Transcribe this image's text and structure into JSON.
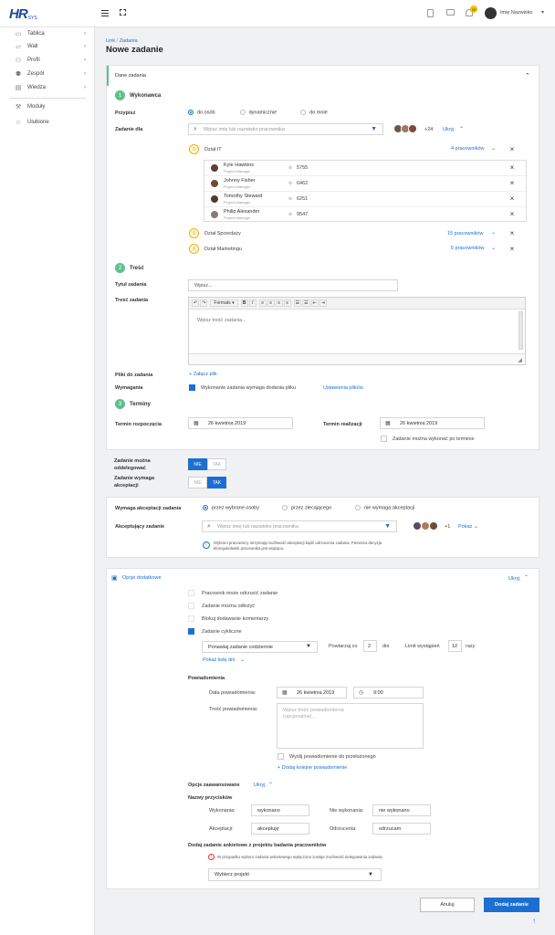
{
  "app": {
    "logo_main": "HR",
    "logo_sub": "SYS",
    "user_name": "Imię Nazwisko",
    "notif_count": "19"
  },
  "sidebar": {
    "items": [
      {
        "label": "Tablica",
        "icon": "monitor-icon",
        "chev": true
      },
      {
        "label": "Wall",
        "icon": "folder-icon",
        "chev": true
      },
      {
        "label": "Profil",
        "icon": "user-icon",
        "chev": true
      },
      {
        "label": "Zespół",
        "icon": "team-icon",
        "chev": true
      },
      {
        "label": "Wiedza",
        "icon": "book-icon",
        "chev": true
      },
      {
        "label": "Moduły",
        "icon": "wrench-icon",
        "chev": false
      },
      {
        "label": "Ulubione",
        "icon": "star-icon",
        "chev": false
      }
    ]
  },
  "breadcrumb": {
    "part1": "Link",
    "sep": "/",
    "part2": "Zadania"
  },
  "page_title": "Nowe zadanie",
  "section_main": {
    "title": "Dane zadania"
  },
  "step1": {
    "num": "1",
    "title": "Wykonawca"
  },
  "assign": {
    "label": "Przypisz",
    "options": [
      "do osób",
      "dynamicznie",
      "do mnie"
    ],
    "selected": 0
  },
  "assign_to": {
    "label": "Zadanie dla",
    "placeholder": "Wpisz imię lub nazwisko pracownika",
    "extra_count": "+24",
    "hide_link": "Ukryj"
  },
  "departments": [
    {
      "name": "Dział IT",
      "count_link": "4 pracowników"
    },
    {
      "name": "Dział Sprzedaży",
      "count_link": "15 pracowników"
    },
    {
      "name": "Dział Marketingu",
      "count_link": "5 pracowników"
    }
  ],
  "employees": [
    {
      "name": "Kyle Hawkins",
      "role": "Project Manager",
      "id": "5755"
    },
    {
      "name": "Johnny Fisher",
      "role": "Project Manager",
      "id": "6462"
    },
    {
      "name": "Tomothy Steward",
      "role": "Project Manager",
      "id": "6251"
    },
    {
      "name": "Philip Alexander",
      "role": "Project Manager",
      "id": "9547"
    }
  ],
  "step2": {
    "num": "2",
    "title": "Treść"
  },
  "task_title": {
    "label": "Tytuł zadania",
    "placeholder": "Wpisz..."
  },
  "task_body": {
    "label": "Treść zadania",
    "placeholder": "Wpisz treść zadania...",
    "formats": "Formats"
  },
  "files": {
    "label": "Pliki do zadania",
    "attach": "+ Załącz plik"
  },
  "req": {
    "label": "Wymagania",
    "checkbox": "Wykonanie zadania wymaga dodania pliku",
    "settings_link": "Ustawienia plików"
  },
  "step3": {
    "num": "3",
    "title": "Terminy"
  },
  "start": {
    "label": "Termin rozpoczęcia",
    "value": "26 kwietnia 2019"
  },
  "due": {
    "label": "Termin realizacji",
    "value": "26 kwietnia 2019",
    "after": "Zadanie można wykonać po terminie"
  },
  "delegate": {
    "label": "Zadanie można oddelegować",
    "no": "NIE",
    "yes": "TAK",
    "selected": "no"
  },
  "accept_req": {
    "label": "Zadanie wymaga akceptacji",
    "no": "NIE",
    "yes": "TAK",
    "selected": "yes"
  },
  "accept": {
    "label": "Wymaga akceptacji zadania",
    "options": [
      "przez wybrane osoby",
      "przez zlecającego",
      "nie wymaga akceptacji"
    ],
    "acceptor_label": "Akceptujący zadanie",
    "placeholder": "Wpisz imię lub nazwisko pracownika",
    "extra": "+1",
    "show": "Pokaż",
    "info": "Wybrani pracownicy otrzymają możliwość akceptacji bądź odrzucenia zadania. Pierwsza decyzja któregokolwiek pracownika jest wiążąca."
  },
  "extra": {
    "title": "Opcje dodatkowe",
    "hide": "Ukryj",
    "opts": [
      {
        "label": "Pracownik może odrzucić zadanie",
        "on": false
      },
      {
        "label": "Zadanie można odłożyć",
        "on": false
      },
      {
        "label": "Blokuj dodawanie komentarzy",
        "on": false
      },
      {
        "label": "Zadanie cykliczne",
        "on": true
      }
    ],
    "repeat_select": "Ponawiaj zadanie codziennie",
    "repeat_every": "Powtarzaj co",
    "repeat_n": "2",
    "days": "dni",
    "limit": "Limit wystąpień",
    "limit_n": "12",
    "times": "razy",
    "show_days": "Pokaż listę dni"
  },
  "notif": {
    "title": "Powiadomienia",
    "date_label": "Data powiadomienia:",
    "date": "26 kwietnia 2019",
    "time": "9:00",
    "body_label": "Treść powiadomienia:",
    "body_ph": "Wpisz treść powiadomienia (opcjonalnie)...",
    "superior": "Wyślij powiadomienie do przełożonego",
    "add": "+ Dodaj kolejne powiadomienie"
  },
  "advanced": {
    "title": "Opcje zaawansowane",
    "hide": "Ukryj",
    "names_title": "Nazwy przycisków",
    "done_l": "Wykonania:",
    "done_v": "wykonano",
    "notdone_l": "Nie wykonania:",
    "notdone_v": "nie wykonano",
    "acc_l": "Akceptacji:",
    "acc_v": "akceptuję",
    "rej_l": "Odrzucenia:",
    "rej_v": "odrzucam",
    "survey_title": "Dodaj zadanie ankietowe z projektu badania pracowników",
    "survey_warn": "W przypadku wyboru zadania ankietowego wyłączona zostaje możliwość delegowania zadania.",
    "project_select": "Wybierz projekt"
  },
  "actions": {
    "cancel": "Anuluj",
    "submit": "Dodaj zadanie"
  },
  "colors": {
    "accent": "#1c6fd1",
    "step": "#5cc18b",
    "group": "#f0b400",
    "danger": "#e03030"
  }
}
